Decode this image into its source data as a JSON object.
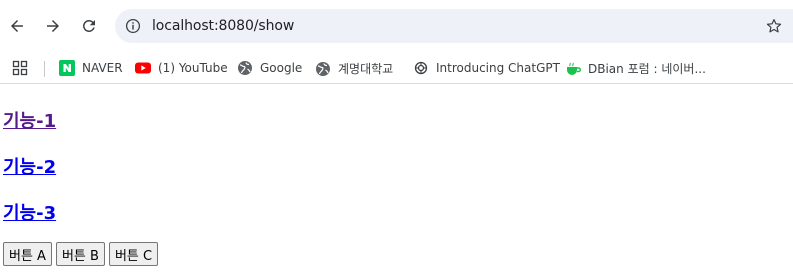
{
  "browser": {
    "url": "localhost:8080/show",
    "bookmarks": [
      {
        "label": "NAVER",
        "icon": "naver-icon"
      },
      {
        "label": "(1) YouTube",
        "icon": "youtube-icon"
      },
      {
        "label": "Google",
        "icon": "globe-icon"
      },
      {
        "label": "계명대학교",
        "icon": "globe-icon"
      },
      {
        "label": "Introducing ChatGPT",
        "icon": "openai-icon"
      },
      {
        "label": "DBian 포럼 : 네이버...",
        "icon": "cup-icon"
      }
    ]
  },
  "page": {
    "links": [
      {
        "label": "기능-1",
        "visited": true
      },
      {
        "label": "기능-2",
        "visited": false
      },
      {
        "label": "기능-3",
        "visited": false
      }
    ],
    "buttons": [
      "버튼 A",
      "버튼 B",
      "버튼 C"
    ]
  },
  "colors": {
    "link": "#0000ee",
    "visited_link": "#551a8b",
    "naver_green": "#03c75a",
    "youtube_red": "#ff0000",
    "omnibox_bg": "#eef1f8"
  }
}
